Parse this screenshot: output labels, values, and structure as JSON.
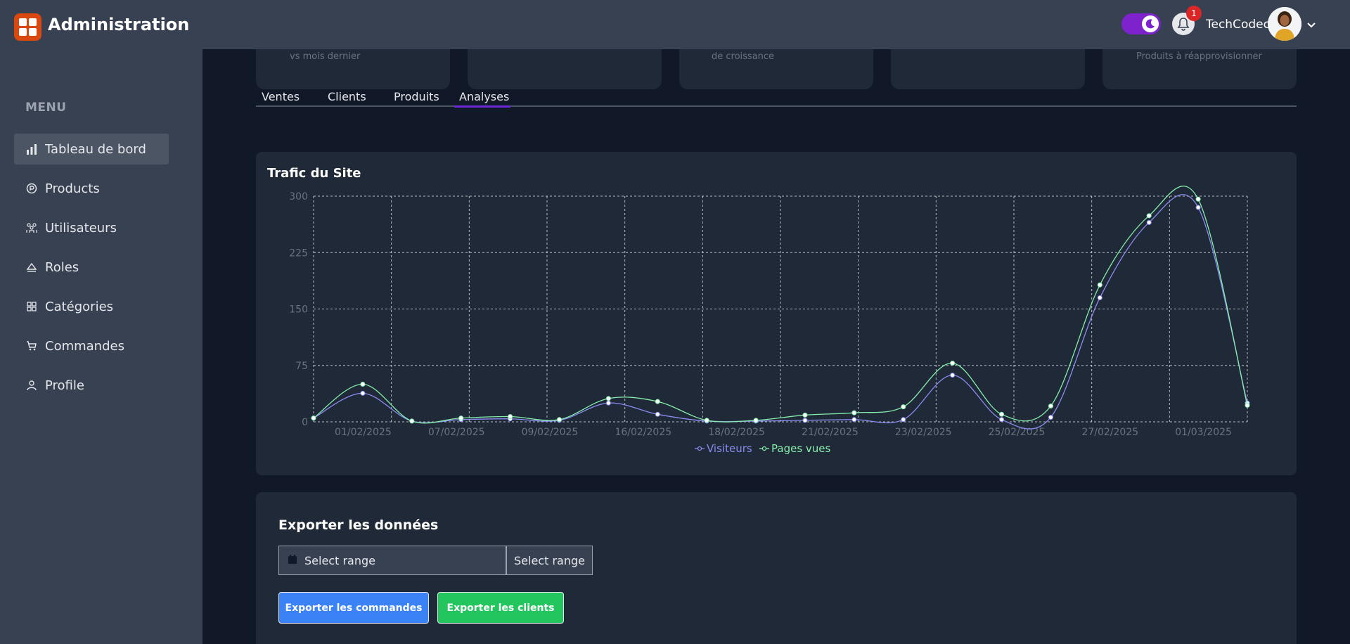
{
  "header": {
    "app_title": "Administration",
    "notification_count": "1",
    "username": "TechCodec"
  },
  "sidebar": {
    "menu_title": "MENU",
    "items": [
      {
        "label": "Tableau de bord",
        "icon": "bar-chart-icon",
        "active": true
      },
      {
        "label": "Products",
        "icon": "product-icon",
        "active": false
      },
      {
        "label": "Utilisateurs",
        "icon": "users-icon",
        "active": false
      },
      {
        "label": "Roles",
        "icon": "roles-icon",
        "active": false
      },
      {
        "label": "Catégories",
        "icon": "grid-icon",
        "active": false
      },
      {
        "label": "Commandes",
        "icon": "cart-icon",
        "active": false
      },
      {
        "label": "Profile",
        "icon": "user-icon",
        "active": false
      }
    ]
  },
  "stats": {
    "card1_sub": "vs mois dernier",
    "card3_sub": "de croissance",
    "card5_sub": "Produits à réapprovisionner"
  },
  "tabs": [
    "Ventes",
    "Clients",
    "Produits",
    "Analyses"
  ],
  "active_tab": "Analyses",
  "chart": {
    "title": "Trafic du Site"
  },
  "chart_data": {
    "type": "line",
    "title": "Trafic du Site",
    "ylim": [
      0,
      300
    ],
    "y_ticks": [
      0,
      75,
      150,
      225,
      300
    ],
    "x_tick_labels": [
      "01/02/2025",
      "07/02/2025",
      "09/02/2025",
      "16/02/2025",
      "18/02/2025",
      "21/02/2025",
      "23/02/2025",
      "25/02/2025",
      "27/02/2025",
      "01/03/2025"
    ],
    "grid": true,
    "legend": "bottom",
    "series": [
      {
        "name": "Visiteurs",
        "color": "#8b8cf0",
        "values": [
          5,
          38,
          1,
          3,
          4,
          2,
          25,
          10,
          1,
          1,
          2,
          3,
          3,
          62,
          3,
          6,
          165,
          265,
          285,
          25
        ]
      },
      {
        "name": "Pages vues",
        "color": "#86efac",
        "values": [
          5,
          50,
          1,
          5,
          7,
          3,
          31,
          27,
          2,
          2,
          9,
          12,
          20,
          78,
          10,
          21,
          182,
          274,
          296,
          22
        ]
      }
    ]
  },
  "export": {
    "title": "Exporter les données",
    "date_placeholder": "Select range",
    "date_placeholder2": "Select range",
    "btn_orders": "Exporter les commandes",
    "btn_clients": "Exporter les clients"
  }
}
